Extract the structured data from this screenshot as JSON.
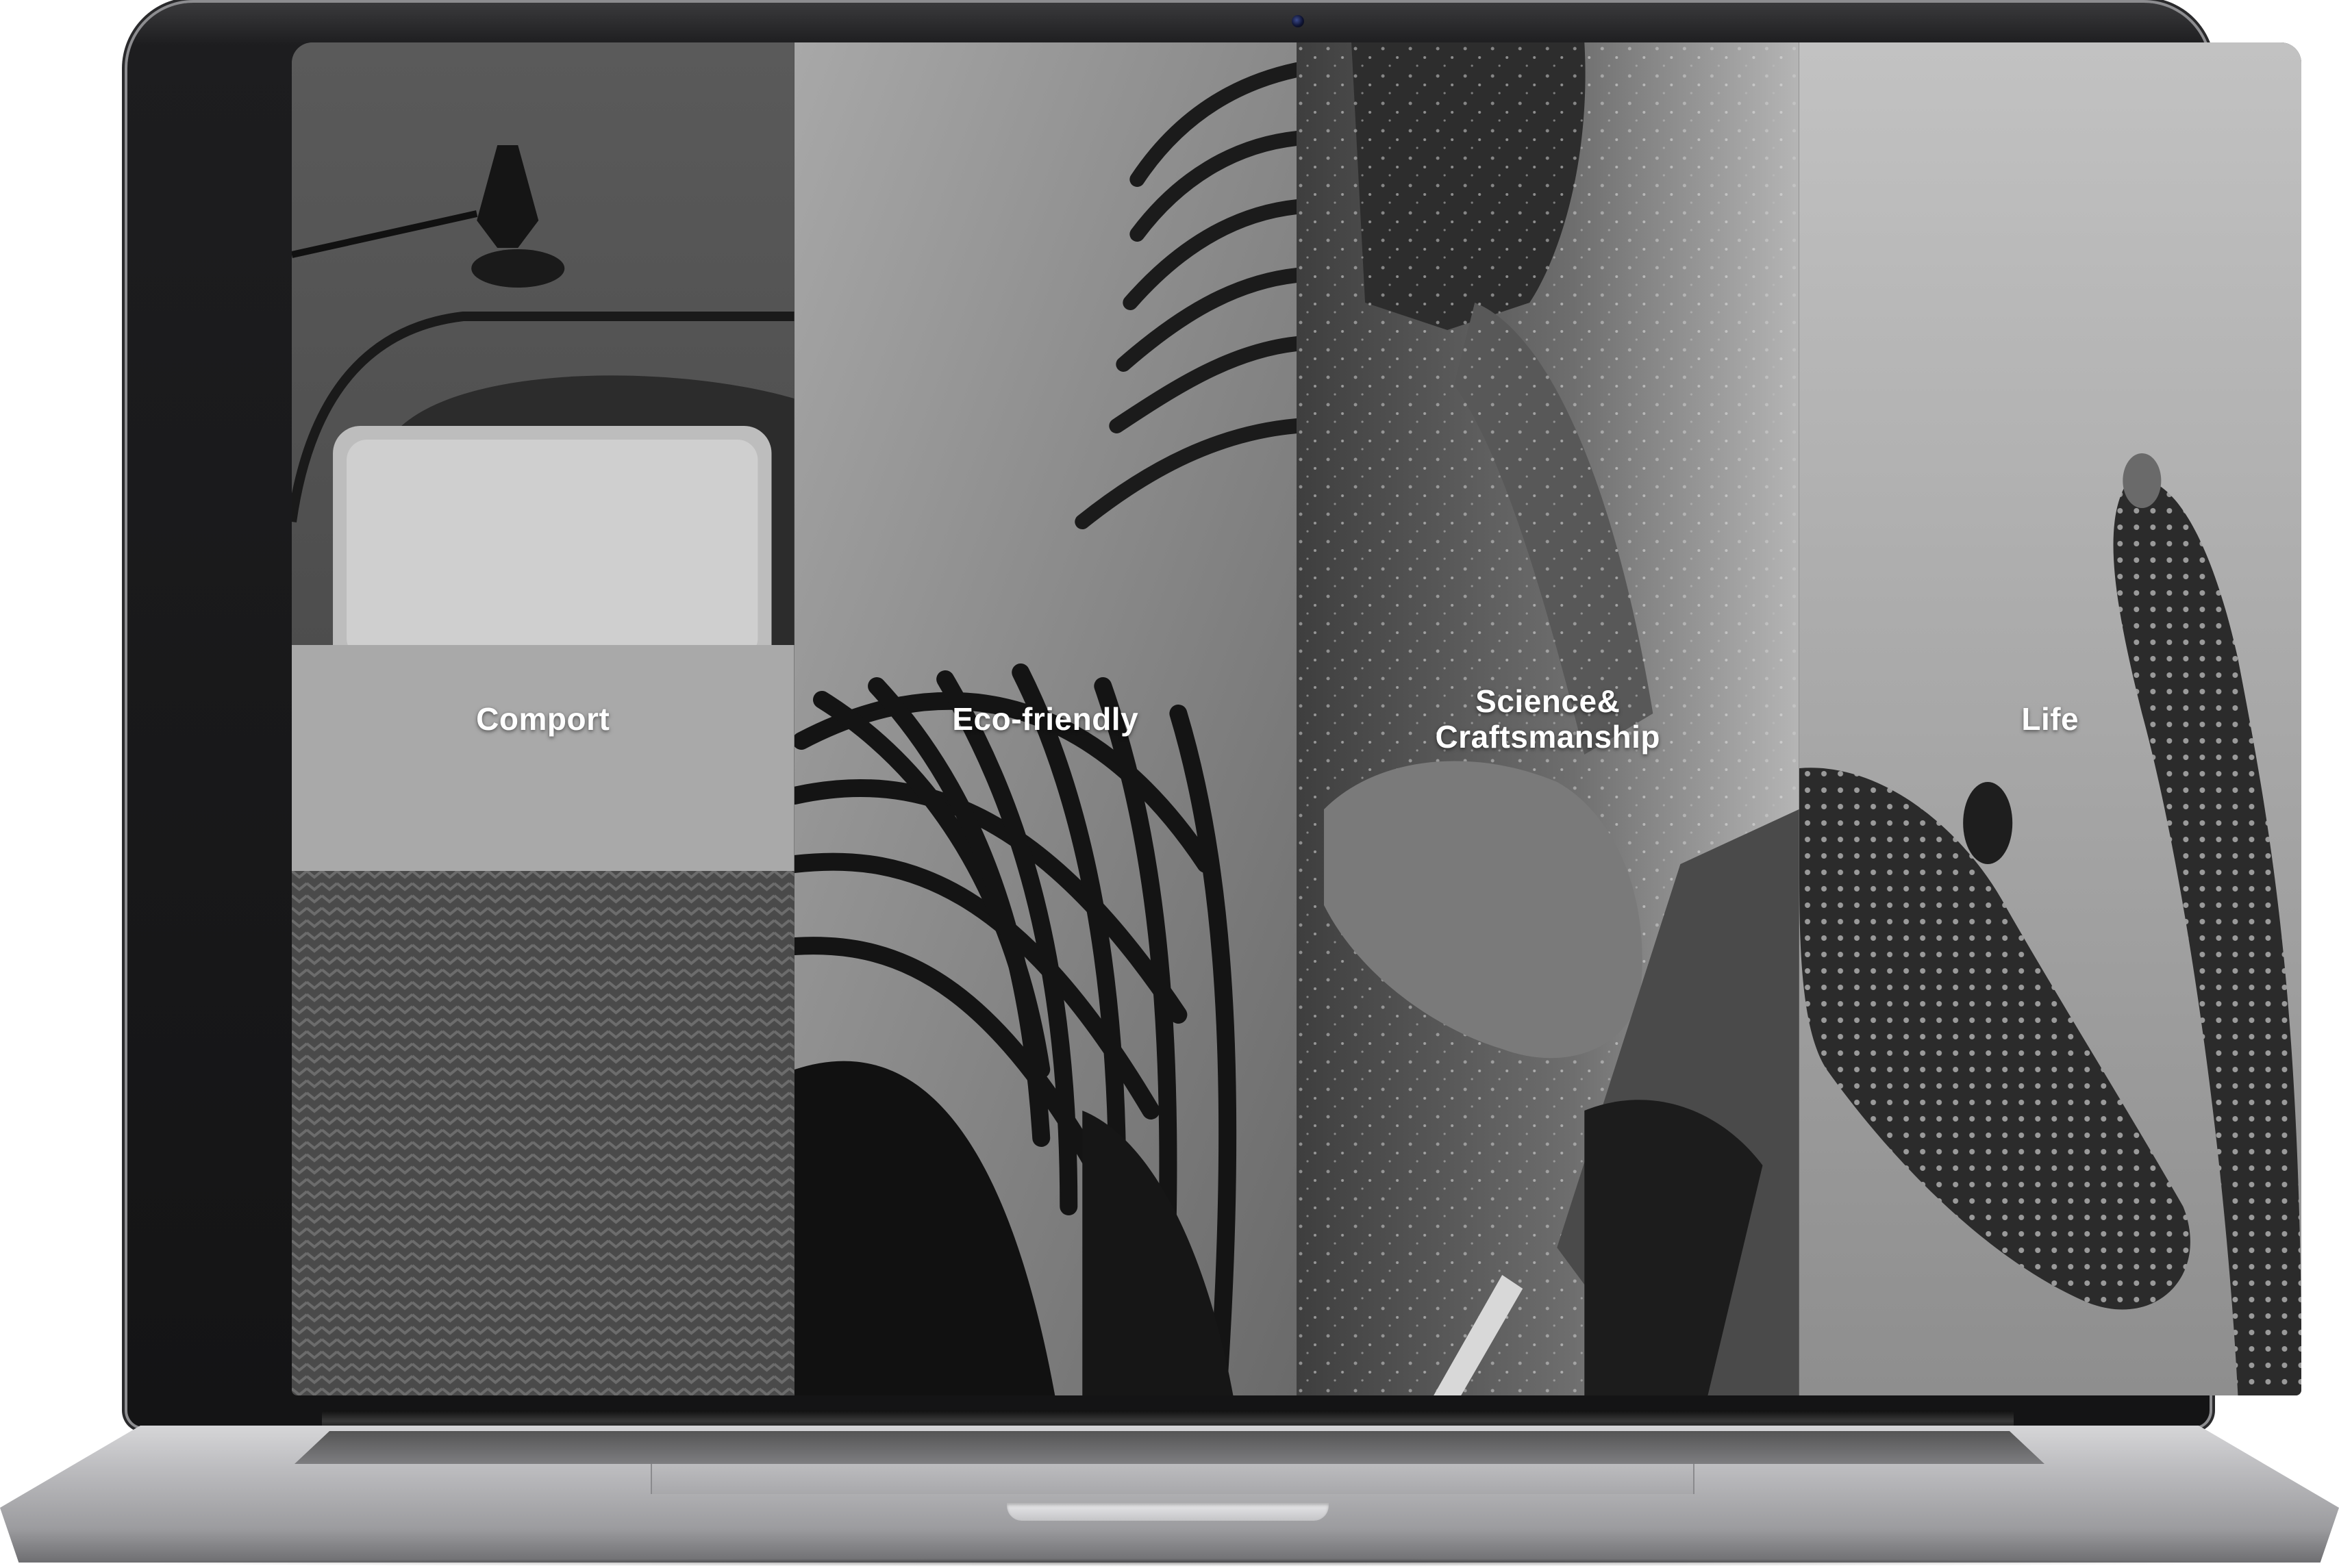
{
  "panels": [
    {
      "label": "Comport",
      "icon": "bed-with-lamp-photo"
    },
    {
      "label": "Eco-friendly",
      "icon": "palm-leaves-photo"
    },
    {
      "label": "Science&\nCraftsmanship",
      "icon": "woodcarving-hands-photo"
    },
    {
      "label": "Life",
      "icon": "cactus-photo"
    }
  ],
  "colors": {
    "label_text": "#ffffff",
    "bezel": "#141415",
    "base": "#bdbdc0"
  }
}
